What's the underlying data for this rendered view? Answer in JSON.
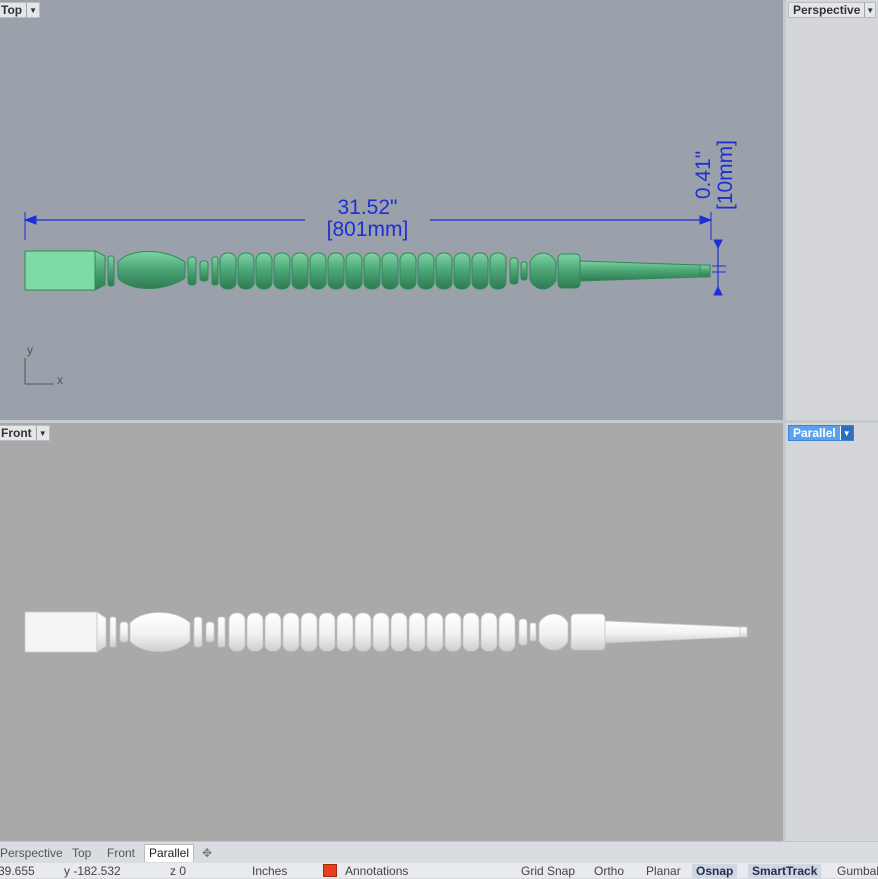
{
  "viewports": {
    "top": {
      "label": "Top"
    },
    "perspective": {
      "label": "Perspective"
    },
    "front": {
      "label": "Front"
    },
    "parallel": {
      "label": "Parallel"
    }
  },
  "dimensions": {
    "length_in": "31.52\"",
    "length_mm": "[801mm]",
    "width_in": "0.41\"",
    "width_mm": "[10mm]"
  },
  "axis": {
    "y": "y",
    "x": "x"
  },
  "view_tabs": [
    "Perspective",
    "Top",
    "Front",
    "Parallel"
  ],
  "active_tab": "Parallel",
  "status": {
    "x": "39.655",
    "y": "y -182.532",
    "z": "z 0",
    "units": "Inches",
    "layer": "Annotations",
    "toggles": [
      "Grid Snap",
      "Ortho",
      "Planar",
      "Osnap",
      "SmartTrack",
      "Gumbal"
    ],
    "active_toggles": [
      "Osnap",
      "SmartTrack"
    ]
  },
  "colors": {
    "dimension": "#1e2fd6",
    "selected_object": "#5ebf8a",
    "layer_swatch": "#e8401c",
    "active_viewport_label": "#5aa2ee"
  }
}
